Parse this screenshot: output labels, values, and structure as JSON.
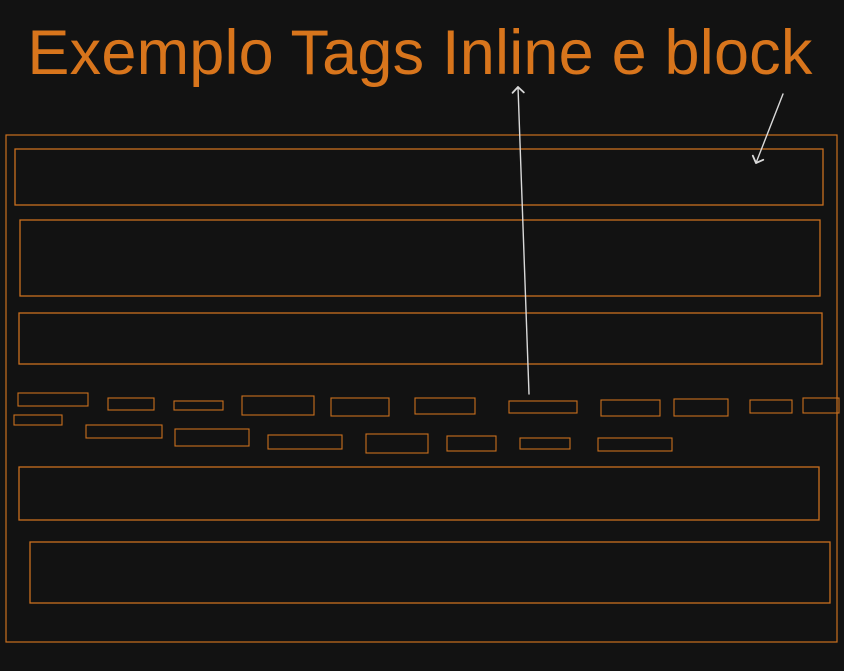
{
  "title": "Exemplo Tags Inline e block",
  "colors": {
    "background": "#121212",
    "accent": "#d8751c",
    "box_stroke": "#c96f1e",
    "arrow": "#d9d9d9"
  },
  "diagram": {
    "outer_container": {
      "kind": "container"
    },
    "block_elements": [
      {
        "id": "block-1",
        "kind": "block"
      },
      {
        "id": "block-2",
        "kind": "block"
      },
      {
        "id": "block-3",
        "kind": "block"
      },
      {
        "id": "block-4",
        "kind": "block"
      },
      {
        "id": "block-5",
        "kind": "block"
      }
    ],
    "inline_elements_row_1": [
      {
        "id": "inline-1-1",
        "kind": "inline"
      },
      {
        "id": "inline-1-2",
        "kind": "inline"
      },
      {
        "id": "inline-1-3",
        "kind": "inline"
      },
      {
        "id": "inline-1-4",
        "kind": "inline"
      },
      {
        "id": "inline-1-5",
        "kind": "inline"
      },
      {
        "id": "inline-1-6",
        "kind": "inline"
      },
      {
        "id": "inline-1-7",
        "kind": "inline"
      },
      {
        "id": "inline-1-8",
        "kind": "inline"
      },
      {
        "id": "inline-1-9",
        "kind": "inline"
      },
      {
        "id": "inline-1-10",
        "kind": "inline"
      },
      {
        "id": "inline-1-11",
        "kind": "inline"
      }
    ],
    "inline_elements_row_2": [
      {
        "id": "inline-2-1",
        "kind": "inline"
      },
      {
        "id": "inline-2-2",
        "kind": "inline"
      },
      {
        "id": "inline-2-3",
        "kind": "inline"
      },
      {
        "id": "inline-2-4",
        "kind": "inline"
      },
      {
        "id": "inline-2-5",
        "kind": "inline"
      },
      {
        "id": "inline-2-6",
        "kind": "inline"
      },
      {
        "id": "inline-2-7",
        "kind": "inline"
      },
      {
        "id": "inline-2-8",
        "kind": "inline"
      }
    ],
    "arrows": [
      {
        "id": "arrow-to-inline",
        "points_to": "inline"
      },
      {
        "id": "arrow-to-block",
        "points_to": "block"
      }
    ]
  }
}
